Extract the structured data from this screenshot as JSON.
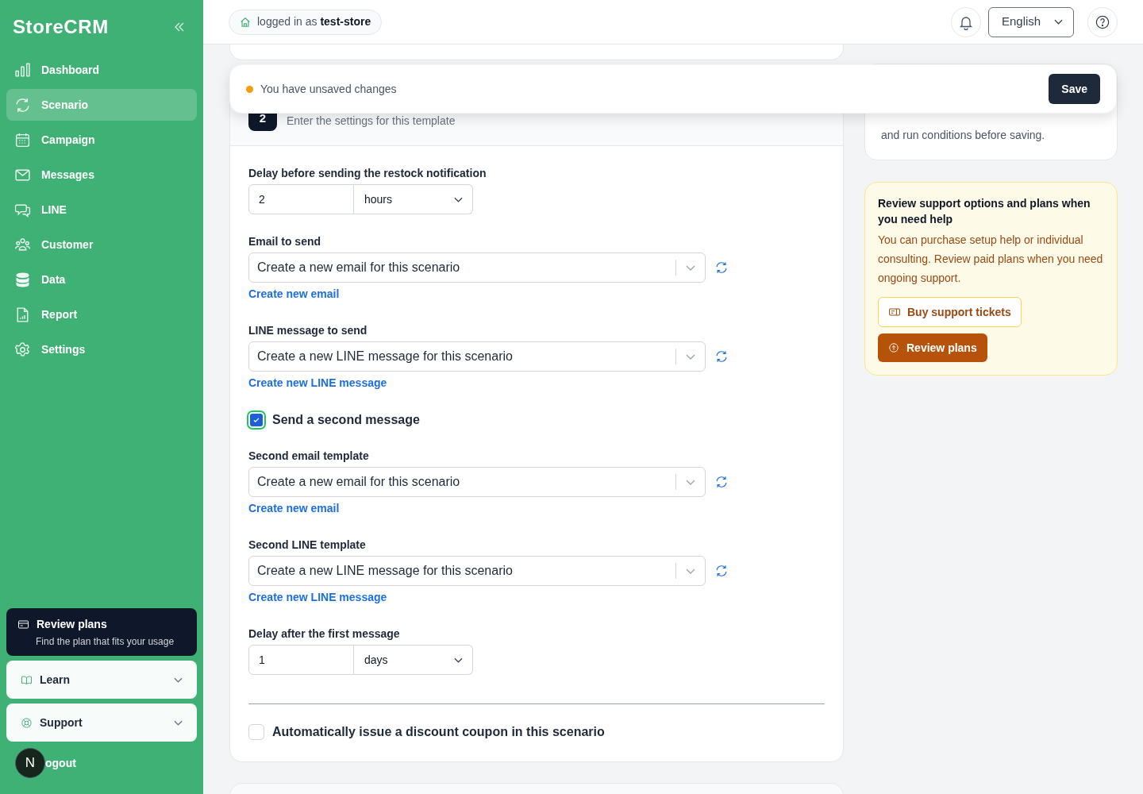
{
  "sidebar": {
    "brand": "StoreCRM",
    "items": [
      {
        "label": "Dashboard",
        "selected": false
      },
      {
        "label": "Scenario",
        "selected": true
      },
      {
        "label": "Campaign",
        "selected": false
      },
      {
        "label": "Messages",
        "selected": false
      },
      {
        "label": "LINE",
        "selected": false
      },
      {
        "label": "Customer",
        "selected": false
      },
      {
        "label": "Data",
        "selected": false
      },
      {
        "label": "Report",
        "selected": false
      },
      {
        "label": "Settings",
        "selected": false
      }
    ],
    "promo": {
      "title": "Review plans",
      "subtitle": "Find the plan that fits your usage"
    },
    "sections": [
      {
        "label": "Learn",
        "expanded": false
      },
      {
        "label": "Support",
        "expanded": false
      }
    ],
    "avatar": "N",
    "logout": "ogout"
  },
  "header": {
    "login_prefix": "logged in as",
    "login_user": "test-store",
    "language": "English"
  },
  "save_bar": {
    "message": "You have unsaved changes",
    "button": "Save"
  },
  "form": {
    "step": "2",
    "subtitle": "Enter the settings for this template",
    "fields": [
      {
        "kind": "delay",
        "label": "Delay before sending the restock notification",
        "value": "2",
        "unit": "hours"
      },
      {
        "kind": "select",
        "label": "Email to send",
        "value": "Create a new email for this scenario",
        "link": "Create new email"
      },
      {
        "kind": "select",
        "label": "LINE message to send",
        "value": "Create a new LINE message for this scenario",
        "link": "Create new LINE message"
      },
      {
        "kind": "checkbox",
        "label": "Send a second message",
        "checked": true,
        "focused": true
      },
      {
        "kind": "select",
        "label": "Second email template",
        "value": "Create a new email for this scenario",
        "link": "Create new email"
      },
      {
        "kind": "select",
        "label": "Second LINE template",
        "value": "Create a new LINE message for this scenario",
        "link": "Create new LINE message"
      },
      {
        "kind": "delay",
        "label": "Delay after the first message",
        "value": "1",
        "unit": "days"
      },
      {
        "kind": "divider"
      },
      {
        "kind": "checkbox",
        "label": "Automatically issue a discount coupon in this scenario",
        "checked": false,
        "focused": false
      }
    ]
  },
  "summary": {
    "text": "and run conditions before saving."
  },
  "support": {
    "title": "Review support options and plans when you need help",
    "body": "You can purchase setup help or individual consulting. Review paid plans when you need ongoing support.",
    "buttons": [
      {
        "kind": "outline",
        "label": "Buy support tickets"
      },
      {
        "kind": "primary",
        "label": "Review plans"
      }
    ]
  }
}
